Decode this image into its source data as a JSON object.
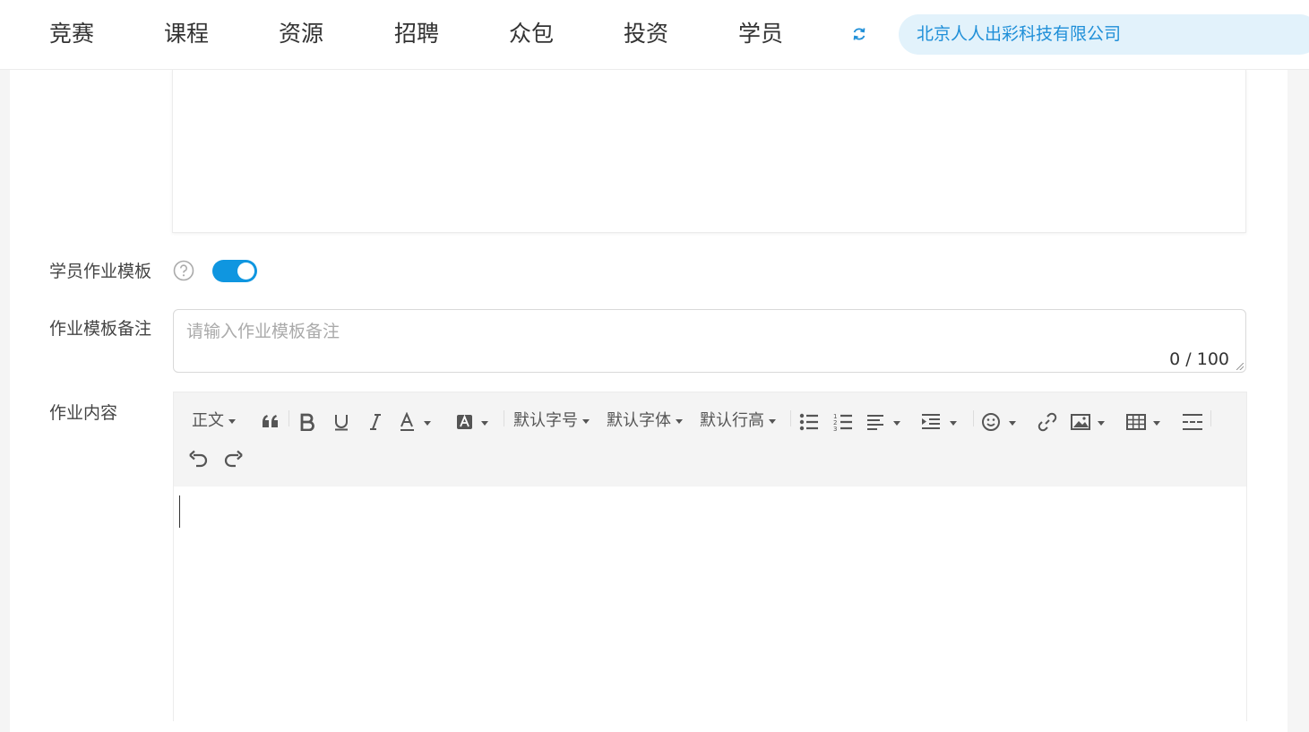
{
  "nav": {
    "items": [
      "竞赛",
      "课程",
      "资源",
      "招聘",
      "众包",
      "投资",
      "学员"
    ],
    "company": "北京人人出彩科技有限公司"
  },
  "form": {
    "template_label": "学员作业模板",
    "template_enabled": true,
    "note_label": "作业模板备注",
    "note_placeholder": "请输入作业模板备注",
    "note_counter": "0 / 100",
    "content_label": "作业内容"
  },
  "editor": {
    "heading_select": "正文",
    "font_size_select": "默认字号",
    "font_family_select": "默认字体",
    "line_height_select": "默认行高",
    "tools": [
      "quote-icon",
      "bold-icon",
      "underline-icon",
      "italic-icon",
      "font-color-icon",
      "background-color-icon",
      "bullet-list-icon",
      "numbered-list-icon",
      "align-icon",
      "indent-icon",
      "emoji-icon",
      "link-icon",
      "image-icon",
      "table-icon",
      "divider-icon",
      "undo-icon",
      "redo-icon"
    ]
  },
  "colors": {
    "accent": "#0f96e0",
    "company_pill_bg": "#e2f2fb",
    "company_text": "#1f8fd8"
  }
}
